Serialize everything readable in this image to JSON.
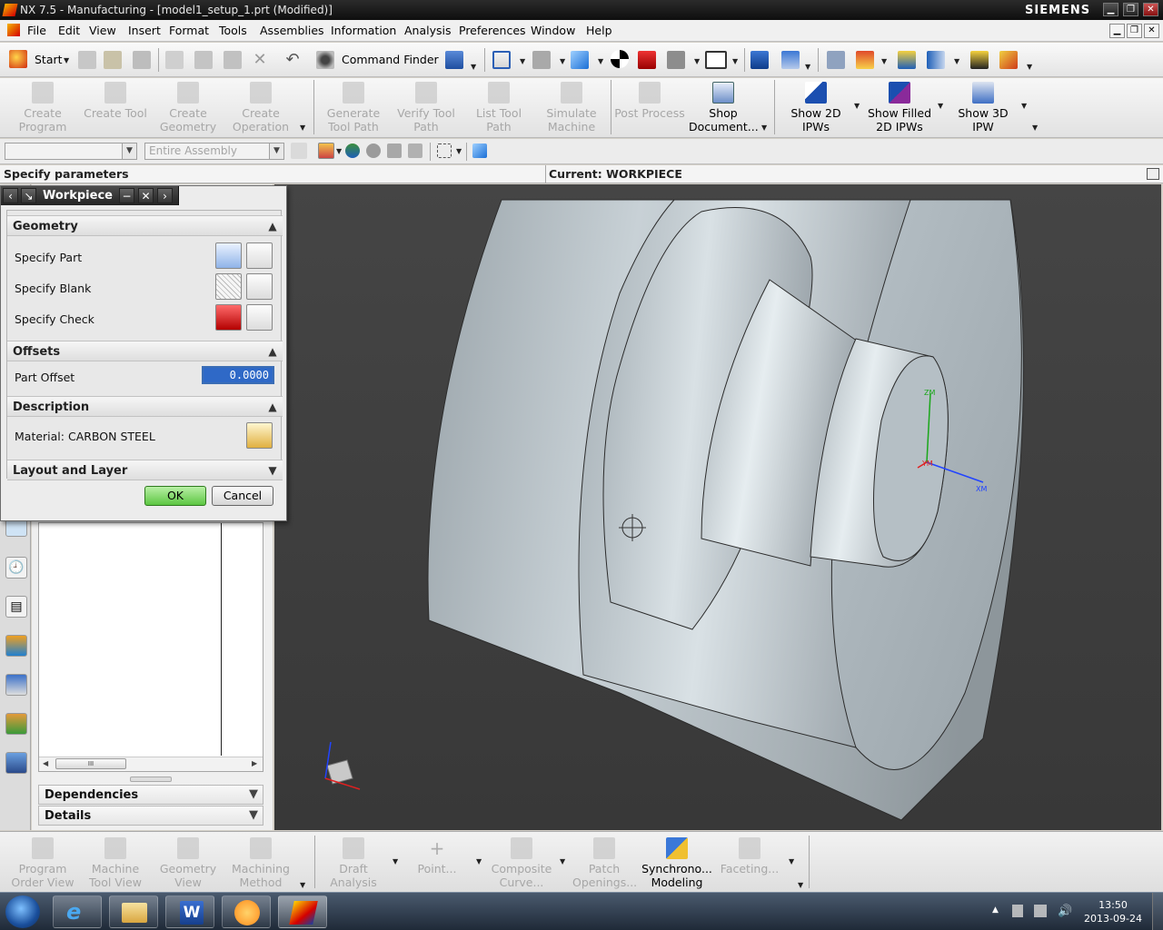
{
  "window": {
    "title": "NX 7.5 - Manufacturing - [model1_setup_1.prt (Modified)]",
    "brand": "SIEMENS"
  },
  "menu": [
    "File",
    "Edit",
    "View",
    "Insert",
    "Format",
    "Tools",
    "Assemblies",
    "Information",
    "Analysis",
    "Preferences",
    "Window",
    "Help"
  ],
  "toolbar_top": {
    "start_label": "Start",
    "command_finder_label": "Command Finder"
  },
  "toolbar_main": {
    "create_program": "Create\nProgram",
    "create_tool": "Create Tool",
    "create_geometry": "Create\nGeometry",
    "create_operation": "Create\nOperation",
    "generate_tool_path": "Generate\nTool Path",
    "verify_tool_path": "Verify Tool\nPath",
    "list_tool_path": "List Tool\nPath",
    "simulate_machine": "Simulate\nMachine",
    "post_process": "Post Process",
    "shop_document": "Shop\nDocument...",
    "show_2d_ipws": "Show 2D\nIPWs",
    "show_filled_2d_ipws": "Show Filled\n2D IPWs",
    "show_3d_ipw": "Show 3D\nIPW"
  },
  "selection_bar": {
    "filter_value": "",
    "scope_value": "Entire Assembly"
  },
  "status": {
    "prompt": "Specify parameters",
    "current": "Current: WORKPIECE"
  },
  "dialog": {
    "title": "Workpiece",
    "geometry": {
      "header": "Geometry",
      "specify_part": "Specify Part",
      "specify_blank": "Specify Blank",
      "specify_check": "Specify Check"
    },
    "offsets": {
      "header": "Offsets",
      "part_offset_label": "Part Offset",
      "part_offset_value": "0.0000"
    },
    "description": {
      "header": "Description",
      "material": "Material: CARBON STEEL"
    },
    "layout": {
      "header": "Layout and Layer"
    },
    "ok": "OK",
    "cancel": "Cancel"
  },
  "navigator": {
    "dependencies": "Dependencies",
    "details": "Details",
    "scroll_mark": "III"
  },
  "viewport": {
    "triad_labels": {
      "zm": "ZM",
      "ym": "YM",
      "xm": "XM"
    }
  },
  "toolbar_bottom": {
    "program_order_view": "Program\nOrder View",
    "machine_tool_view": "Machine\nTool View",
    "geometry_view": "Geometry\nView",
    "machining_method": "Machining\nMethod",
    "draft_analysis": "Draft\nAnalysis",
    "point": "Point...",
    "composite_curve": "Composite\nCurve...",
    "patch_openings": "Patch\nOpenings...",
    "synchronous_modeling": "Synchrono...\nModeling",
    "faceting": "Faceting..."
  },
  "taskbar": {
    "time": "13:50",
    "date": "2013-09-24"
  },
  "colors": {
    "accent": "#2f69c7",
    "ok_green": "#5cc642",
    "viewport_bg": "#404040"
  }
}
